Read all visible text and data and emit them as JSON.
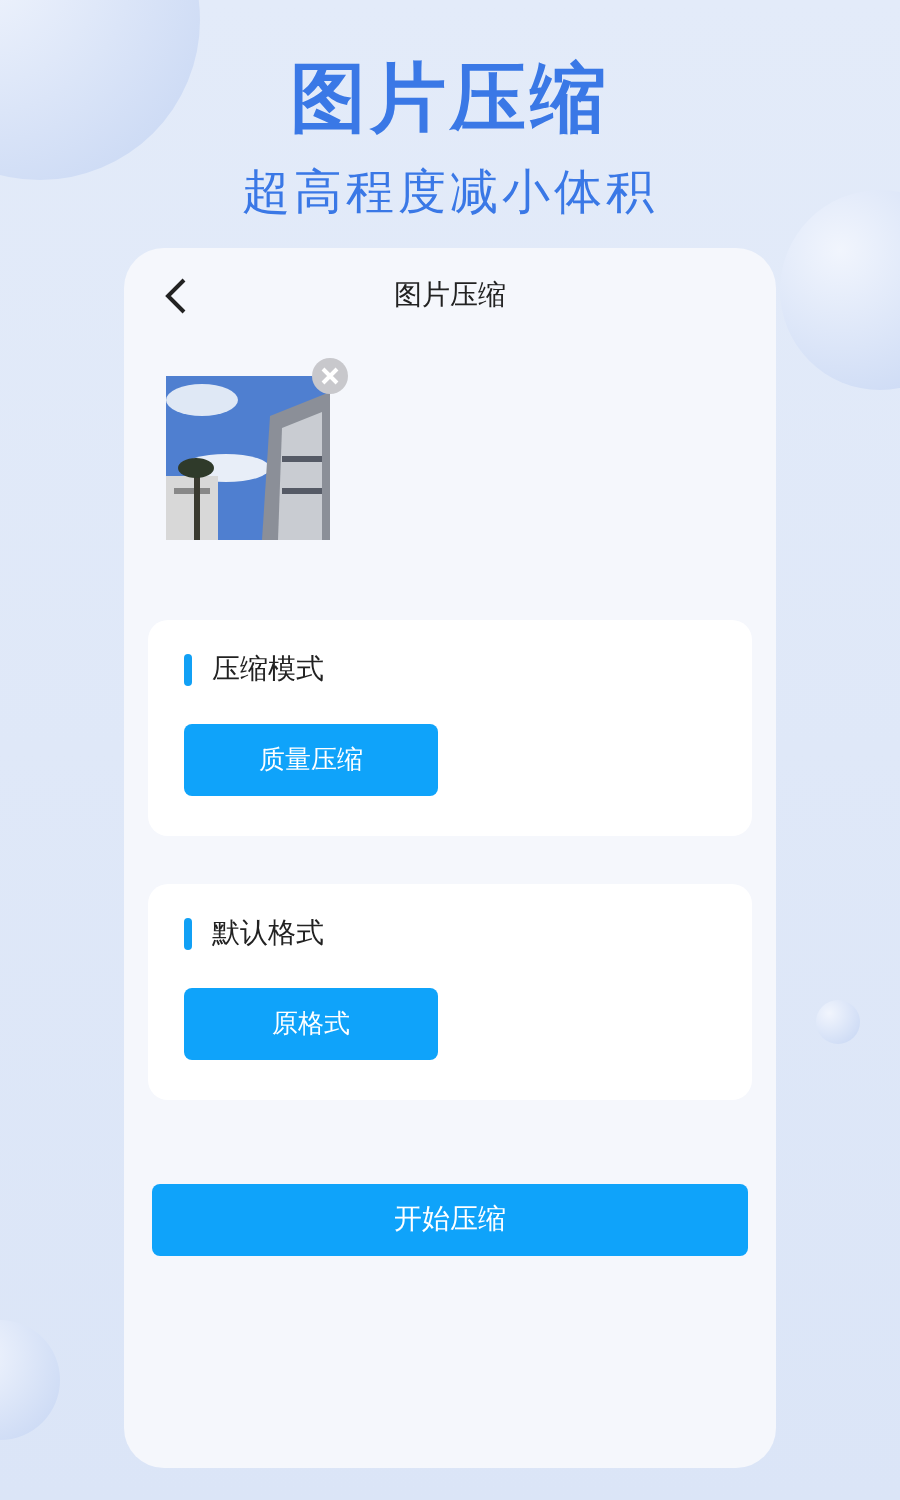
{
  "headline": "图片压缩",
  "subheadline": "超高程度减小体积",
  "screen": {
    "title": "图片压缩",
    "sections": [
      {
        "title": "压缩模式",
        "option": "质量压缩"
      },
      {
        "title": "默认格式",
        "option": "原格式"
      }
    ],
    "start_button": "开始压缩"
  }
}
